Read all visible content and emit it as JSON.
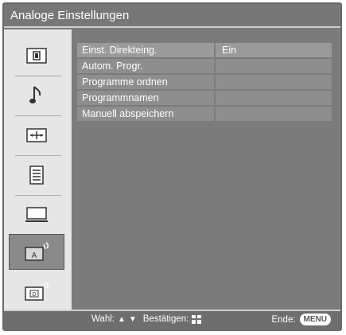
{
  "window": {
    "title": "Analoge Einstellungen"
  },
  "sidebar": {
    "items": [
      {
        "icon": "picture-icon"
      },
      {
        "icon": "music-note-icon"
      },
      {
        "icon": "screen-format-icon"
      },
      {
        "icon": "list-settings-icon"
      },
      {
        "icon": "pc-monitor-icon"
      },
      {
        "icon": "analog-antenna-icon",
        "glyph": "A",
        "selected": true
      },
      {
        "icon": "digital-antenna-icon",
        "glyph": "D"
      }
    ]
  },
  "menu": {
    "rows": [
      {
        "label": "Einst. Direkteing.",
        "value": "Ein"
      },
      {
        "label": "Autom. Progr.",
        "value": ""
      },
      {
        "label": "Programme ordnen",
        "value": ""
      },
      {
        "label": "Programmnamen",
        "value": ""
      },
      {
        "label": "Manuell abspeichern",
        "value": ""
      }
    ]
  },
  "footer": {
    "select_label": "Wahl:",
    "confirm_label": "Bestätigen:",
    "end_label": "Ende:",
    "menu_key": "MENU"
  },
  "colors": {
    "background": "#7b7b7b",
    "row": "#8e8e8e",
    "sidebar": "#e6e6e6",
    "text": "#ffffff"
  }
}
